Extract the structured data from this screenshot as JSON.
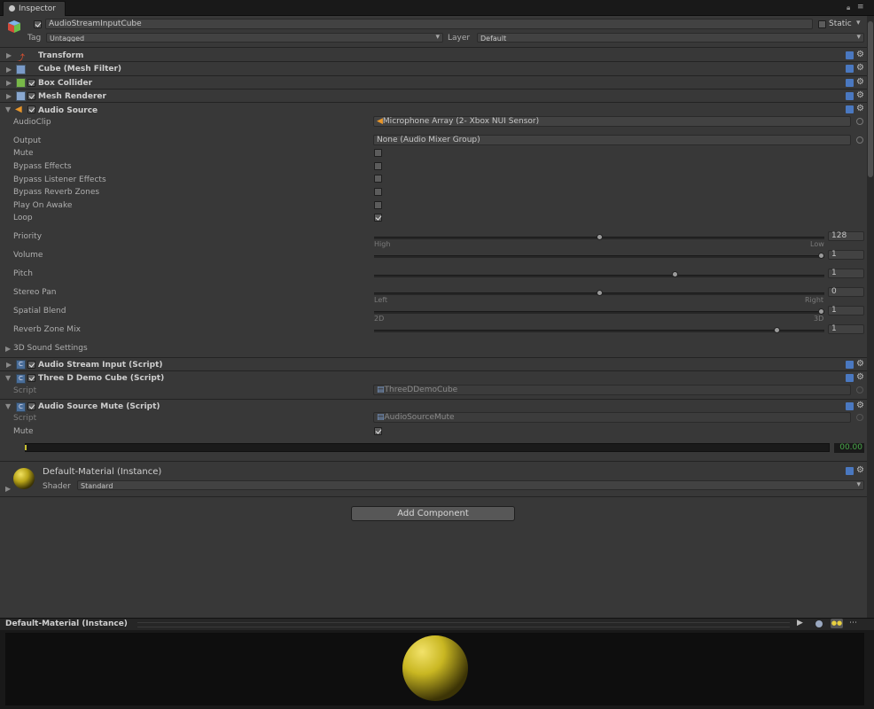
{
  "tab": {
    "title": "Inspector"
  },
  "gameobject": {
    "name": "AudioStreamInputCube",
    "static_label": "Static",
    "tag_label": "Tag",
    "tag_value": "Untagged",
    "layer_label": "Layer",
    "layer_value": "Default"
  },
  "components": {
    "transform": "Transform",
    "mesh_filter": "Cube (Mesh Filter)",
    "box_collider": "Box Collider",
    "mesh_renderer": "Mesh Renderer",
    "audio_source": "Audio Source",
    "audio_stream_input": "Audio Stream Input (Script)",
    "three_d_demo": "Three D Demo Cube (Script)",
    "audio_source_mute": "Audio Source Mute (Script)"
  },
  "audio_source": {
    "audioclip_label": "AudioClip",
    "audioclip_value": "Microphone Array (2- Xbox NUI Sensor)",
    "output_label": "Output",
    "output_value": "None (Audio Mixer Group)",
    "mute_label": "Mute",
    "bypass_effects_label": "Bypass Effects",
    "bypass_listener_label": "Bypass Listener Effects",
    "bypass_reverb_label": "Bypass Reverb Zones",
    "play_on_awake_label": "Play On Awake",
    "loop_label": "Loop",
    "priority_label": "Priority",
    "priority_value": "128",
    "priority_fraction": 0.5,
    "priority_min_label": "High",
    "priority_max_label": "Low",
    "volume_label": "Volume",
    "volume_value": "1",
    "volume_fraction": 1.0,
    "pitch_label": "Pitch",
    "pitch_value": "1",
    "pitch_fraction": 0.67,
    "stereo_pan_label": "Stereo Pan",
    "stereo_pan_value": "0",
    "stereo_pan_fraction": 0.5,
    "stereo_min_label": "Left",
    "stereo_max_label": "Right",
    "spatial_blend_label": "Spatial Blend",
    "spatial_blend_value": "1",
    "spatial_blend_fraction": 1.0,
    "spatial_min_label": "2D",
    "spatial_max_label": "3D",
    "reverb_mix_label": "Reverb Zone Mix",
    "reverb_mix_value": "1",
    "reverb_mix_fraction": 0.9,
    "sound_settings_label": "3D Sound Settings",
    "checks": {
      "mute": false,
      "bypass_effects": false,
      "bypass_listener": false,
      "bypass_reverb": false,
      "play_on_awake": false,
      "loop": true
    }
  },
  "three_d_demo": {
    "script_label": "Script",
    "script_value": "ThreeDDemoCube"
  },
  "audio_source_mute": {
    "script_label": "Script",
    "script_value": "AudioSourceMute",
    "mute_label": "Mute",
    "mute_checked": true,
    "level_value": "00.00"
  },
  "material": {
    "name": "Default-Material (Instance)",
    "shader_label": "Shader",
    "shader_value": "Standard"
  },
  "add_component": "Add Component",
  "preview": {
    "title": "Default-Material (Instance)"
  },
  "colors": {
    "panel_bg": "#383838",
    "sphere": "#c9b722",
    "level_text": "#4aa84a"
  }
}
